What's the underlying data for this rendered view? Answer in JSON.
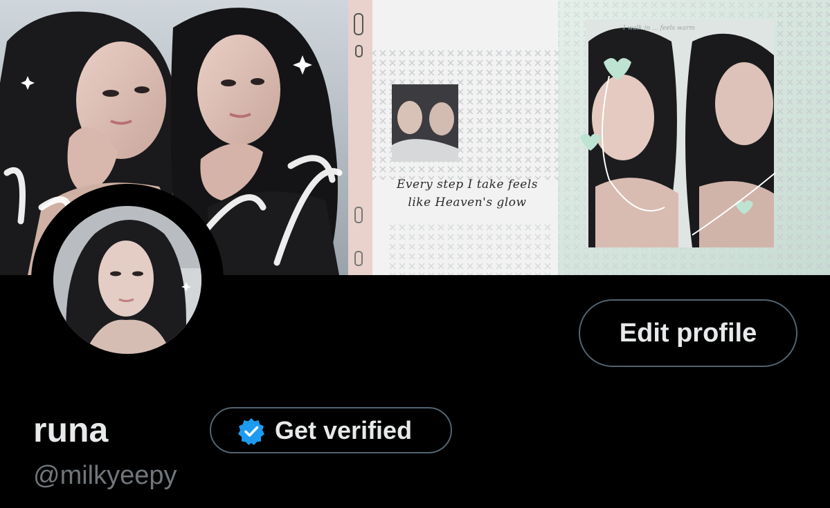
{
  "banner": {
    "quote_line1": "Every step  I take feels",
    "quote_line2": "like  Heaven's glow",
    "caption": "I walk in ... feels warm"
  },
  "profile": {
    "display_name": "runa",
    "handle": "@milkyeepy",
    "edit_profile_label": "Edit profile",
    "get_verified_label": "Get verified"
  },
  "colors": {
    "background": "#000000",
    "primary_text": "#e7e9ea",
    "secondary_text": "#71767b",
    "button_border": "#536471",
    "verified_blue": "#1d9bf0"
  },
  "icons": {
    "verified": "verified-badge-icon"
  }
}
